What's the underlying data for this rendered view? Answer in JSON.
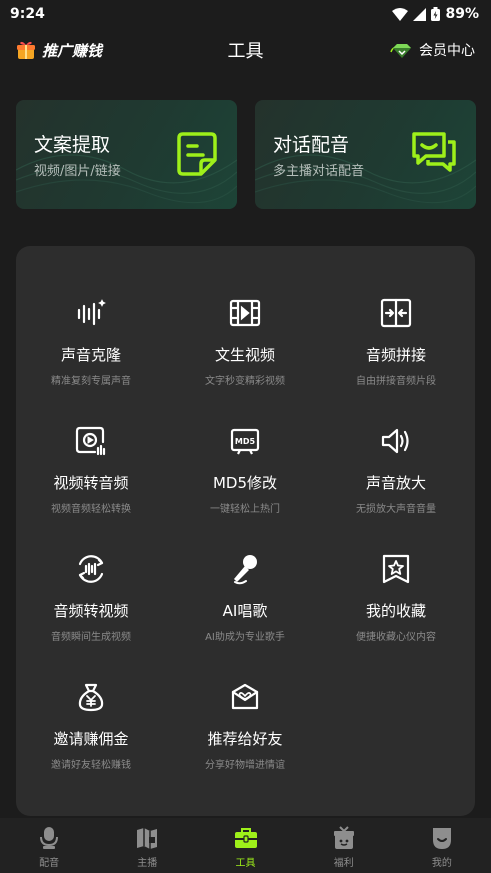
{
  "status_bar": {
    "time": "9:24",
    "battery": "89%"
  },
  "header": {
    "brand": "推广赚钱",
    "title": "工具",
    "vip": "会员中心"
  },
  "feature_cards": [
    {
      "title": "文案提取",
      "subtitle": "视频/图片/链接",
      "icon": "document-extract-icon"
    },
    {
      "title": "对话配音",
      "subtitle": "多主播对话配音",
      "icon": "chat-bubbles-icon"
    }
  ],
  "tools": [
    {
      "name": "声音克隆",
      "desc": "精准复刻专属声音",
      "icon": "voice-clone-icon"
    },
    {
      "name": "文生视频",
      "desc": "文字秒变精彩视频",
      "icon": "film-icon"
    },
    {
      "name": "音频拼接",
      "desc": "自由拼接音频片段",
      "icon": "audio-merge-icon"
    },
    {
      "name": "视频转音频",
      "desc": "视频音频轻松转换",
      "icon": "video-to-audio-icon"
    },
    {
      "name": "MD5修改",
      "desc": "一键轻松上热门",
      "icon": "md5-icon"
    },
    {
      "name": "声音放大",
      "desc": "无损放大声音音量",
      "icon": "speaker-icon"
    },
    {
      "name": "音频转视频",
      "desc": "音频瞬间生成视频",
      "icon": "audio-to-video-icon"
    },
    {
      "name": "AI唱歌",
      "desc": "AI助成为专业歌手",
      "icon": "microphone-icon"
    },
    {
      "name": "我的收藏",
      "desc": "便捷收藏心仪内容",
      "icon": "star-bookmark-icon"
    },
    {
      "name": "邀请赚佣金",
      "desc": "邀请好友轻松赚钱",
      "icon": "money-bag-icon"
    },
    {
      "name": "推荐给好友",
      "desc": "分享好物增进情谊",
      "icon": "share-mail-icon"
    }
  ],
  "bottom_nav": [
    {
      "label": "配音",
      "icon": "microphone-nav-icon"
    },
    {
      "label": "主播",
      "icon": "anchor-nav-icon"
    },
    {
      "label": "工具",
      "icon": "toolbox-nav-icon",
      "active": true
    },
    {
      "label": "福利",
      "icon": "gift-nav-icon"
    },
    {
      "label": "我的",
      "icon": "profile-nav-icon"
    }
  ],
  "colors": {
    "accent": "#9ef01a",
    "background": "#1c1c1c",
    "panel": "#2d2d2d"
  }
}
